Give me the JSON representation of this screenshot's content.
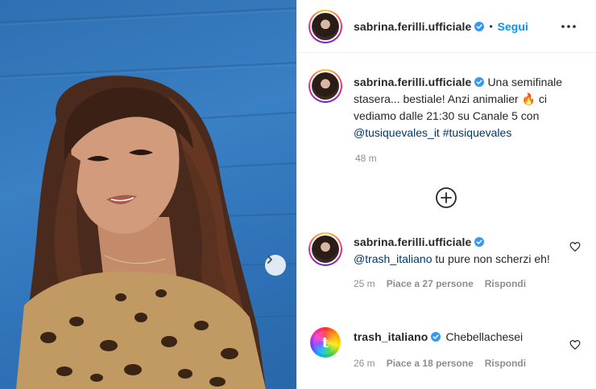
{
  "post": {
    "username": "sabrina.ferilli.ufficiale",
    "dot": "•",
    "follow_label": "Segui",
    "caption": {
      "username": "sabrina.ferilli.ufficiale",
      "text_1": "Una semifinale stasera... bestiale! Anzi animalier ",
      "emoji": "🔥",
      "text_2": " ci vediamo dalle 21:30 su Canale 5 con ",
      "mention": "@tusiquevales_it",
      "space": " ",
      "hashtag": "#tusiquevales",
      "time": "48 m"
    },
    "icons": {
      "verified": "verified-badge-icon",
      "more": "more-options-icon",
      "add": "add-circle-icon",
      "heart": "heart-outline-icon",
      "next": "chevron-right-icon"
    }
  },
  "comments": [
    {
      "username": "sabrina.ferilli.ufficiale",
      "mention": "@trash_italiano",
      "text": " tu pure non scherzi eh!",
      "time": "25 m",
      "likes": "Piace a 27 persone",
      "reply": "Rispondi"
    },
    {
      "username": "trash_italiano",
      "text": "Chebellachesei",
      "time": "26 m",
      "likes": "Piace a 18 persone",
      "reply": "Rispondi",
      "avatar_letter": "t"
    }
  ],
  "colors": {
    "accent": "#0095f6",
    "link": "#00376b",
    "muted": "#8e8e8e",
    "text": "#262626",
    "photo_bg": "#3a80c4"
  }
}
